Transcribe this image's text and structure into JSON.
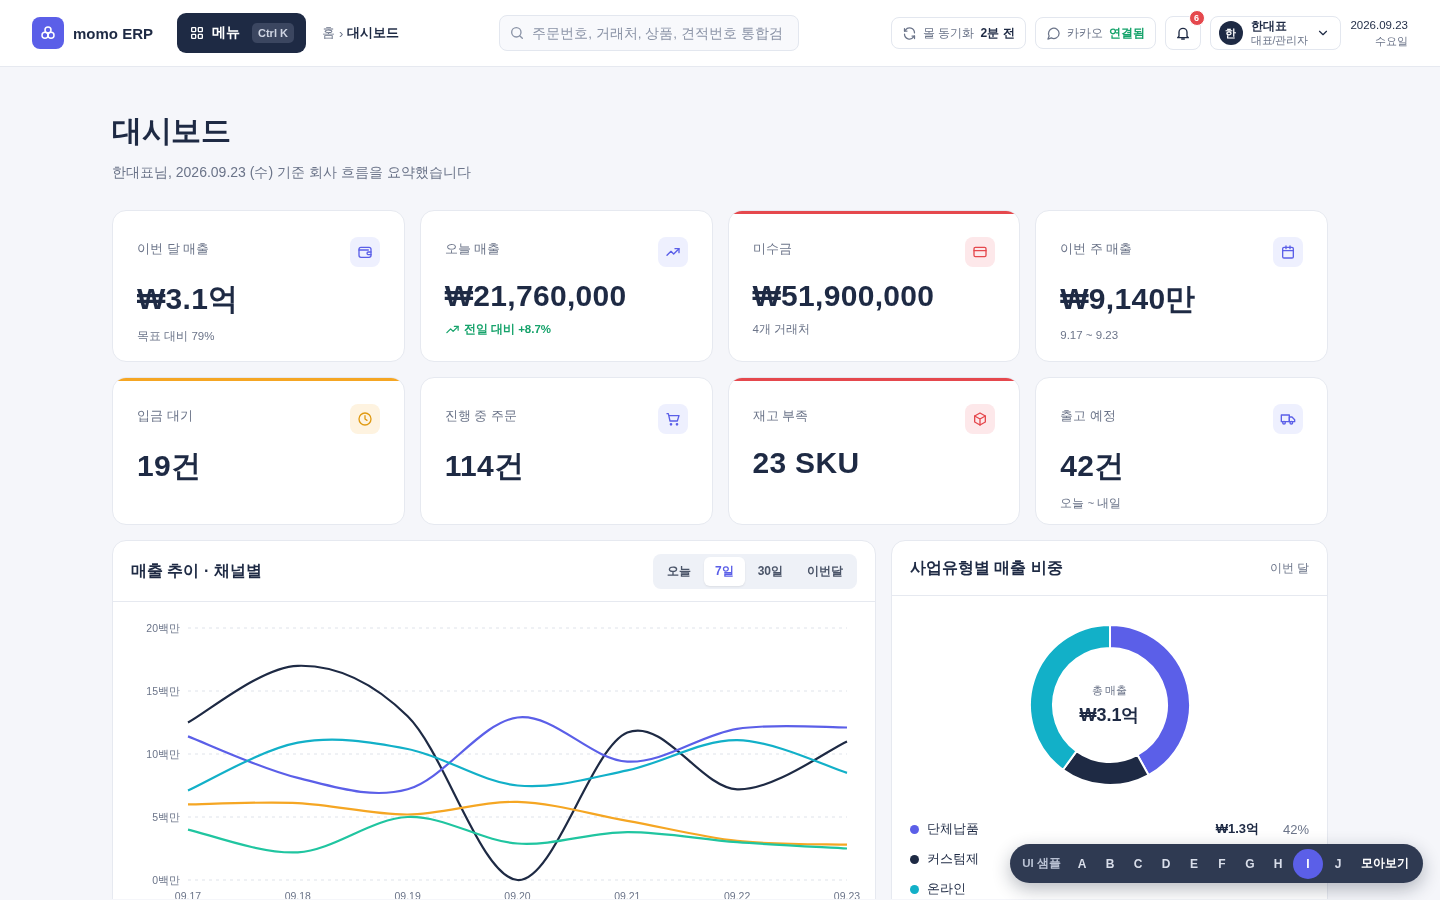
{
  "header": {
    "brand": "momo ERP",
    "menu_button": {
      "label": "메뉴",
      "shortcut": "Ctrl K"
    },
    "breadcrumb": {
      "home": "홈",
      "separator": "›",
      "current": "대시보드"
    },
    "search": {
      "placeholder": "주문번호, 거래처, 상품, 견적번호 통합검"
    },
    "sync": {
      "label": "몰 동기화",
      "status": "2분 전"
    },
    "kakao": {
      "label": "카카오",
      "status": "연결됨"
    },
    "notifications": {
      "count": "6"
    },
    "user": {
      "avatar": "한",
      "name": "한대표",
      "role": "대표/관리자"
    },
    "date": {
      "day": "2026.09.23",
      "weekday": "수요일"
    }
  },
  "page": {
    "title": "대시보드",
    "subtitle": "한대표님, 2026.09.23 (수) 기준 회사 흐름을 요약했습니다"
  },
  "kpis": [
    {
      "label": "이번 달 매출",
      "value": "₩3.1억",
      "kind": "normal",
      "sub": {
        "kind": "plain",
        "text": "목표 대비 79%"
      }
    },
    {
      "label": "오늘 매출",
      "value": "₩21,760,000",
      "kind": "normal",
      "sub": {
        "kind": "up",
        "text": "전일 대비 +8.7%"
      }
    },
    {
      "label": "미수금",
      "value": "₩51,900,000",
      "kind": "danger",
      "sub": {
        "kind": "plain",
        "text": "4개 거래처"
      }
    },
    {
      "label": "이번 주 매출",
      "value": "₩9,140만",
      "kind": "normal",
      "sub": {
        "kind": "plain",
        "text": "9.17 ~ 9.23"
      }
    },
    {
      "label": "입금 대기",
      "value": "19건",
      "kind": "warning"
    },
    {
      "label": "진행 중 주문",
      "value": "114건",
      "kind": "normal"
    },
    {
      "label": "재고 부족",
      "value": "23 SKU",
      "kind": "danger"
    },
    {
      "label": "출고 예정",
      "value": "42건",
      "kind": "normal",
      "sub": {
        "kind": "plain",
        "text": "오늘 ~ 내일"
      }
    }
  ],
  "trend_panel": {
    "title": "매출 추이 · 채널별",
    "tabs": [
      {
        "label": "오늘",
        "selected": false
      },
      {
        "label": "7일",
        "selected": true
      },
      {
        "label": "30일",
        "selected": false
      },
      {
        "label": "이번달",
        "selected": false
      }
    ],
    "chart_data": {
      "type": "line",
      "grid": true,
      "categories": [
        "09.17",
        "09.18",
        "09.19",
        "09.20",
        "09.21",
        "09.22",
        "09.23"
      ],
      "ylim": [
        0,
        20
      ],
      "yticks": [
        {
          "value": 0,
          "label": "0백만"
        },
        {
          "value": 5,
          "label": "5백만"
        },
        {
          "value": 10,
          "label": "10백만"
        },
        {
          "value": 15,
          "label": "15백만"
        },
        {
          "value": 20,
          "label": "20백만"
        }
      ],
      "series": [
        {
          "color": "#1e2a44",
          "values": [
            12.5,
            17,
            13,
            0,
            11.7,
            7.2,
            11
          ]
        },
        {
          "color": "#5b5fe8",
          "values": [
            11.4,
            8.1,
            7.2,
            12.9,
            9.4,
            12,
            12.1
          ]
        },
        {
          "color": "#12b0c8",
          "values": [
            7.1,
            10.9,
            10.4,
            7.5,
            8.7,
            11.1,
            8.5
          ]
        },
        {
          "color": "#f5a623",
          "values": [
            6,
            6.1,
            5.2,
            6.2,
            4.7,
            3.1,
            2.8
          ]
        },
        {
          "color": "#20c5a0",
          "values": [
            4,
            2.2,
            5,
            2.9,
            3.8,
            3.0,
            2.5
          ]
        }
      ]
    }
  },
  "share_panel": {
    "title": "사업유형별 매출 비중",
    "period": "이번 달",
    "center_label": "총 매출",
    "center_value": "₩3.1억",
    "chart_data": {
      "type": "donut",
      "values": [
        42,
        18,
        40
      ]
    },
    "legend": [
      {
        "name": "단체납품",
        "value": "₩1.3억",
        "share": "42%",
        "color": "#5b5fe8"
      },
      {
        "name": "커스텀제",
        "color": "#1e2a44"
      },
      {
        "name": "온라인",
        "color": "#12b0c8"
      }
    ]
  },
  "sample_bar": {
    "label": "UI 샘플",
    "items": [
      {
        "label": "A",
        "selected": false
      },
      {
        "label": "B",
        "selected": false
      },
      {
        "label": "C",
        "selected": false
      },
      {
        "label": "D",
        "selected": false
      },
      {
        "label": "E",
        "selected": false
      },
      {
        "label": "F",
        "selected": false
      },
      {
        "label": "G",
        "selected": false
      },
      {
        "label": "H",
        "selected": false
      },
      {
        "label": "I",
        "selected": true
      },
      {
        "label": "J",
        "selected": false
      }
    ],
    "action": "모아보기"
  }
}
